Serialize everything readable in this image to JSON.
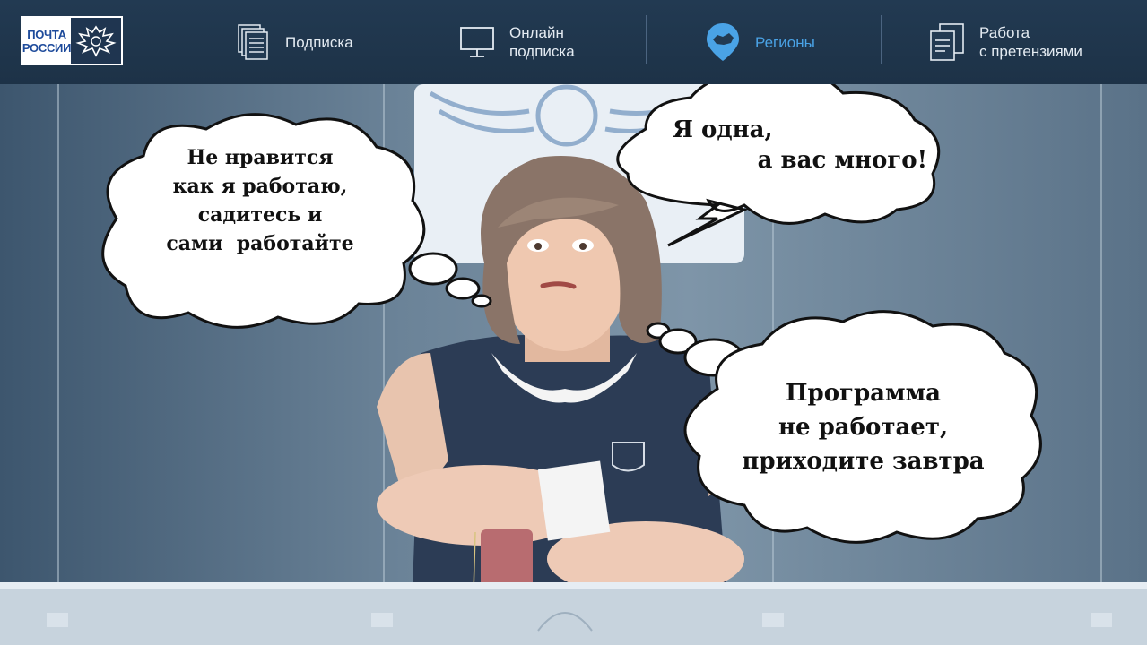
{
  "logo": {
    "line1": "ПОЧТА",
    "line2": "РОССИИ"
  },
  "nav": [
    {
      "label": "Подписка",
      "icon": "documents-icon",
      "active": false
    },
    {
      "label_line1": "Онлайн",
      "label_line2": "подписка",
      "icon": "monitor-icon",
      "active": false
    },
    {
      "label": "Регионы",
      "icon": "map-pin-icon",
      "active": true
    },
    {
      "label_line1": "Работа",
      "label_line2": "с претензиями",
      "icon": "claims-document-icon",
      "active": false
    }
  ],
  "bubbles": {
    "left": [
      "Не нравится",
      "как я работаю,",
      "садитесь и",
      "сами  работайте"
    ],
    "top_right": [
      "Я одна,",
      "а вас много!"
    ],
    "bottom_right": [
      "Программа",
      "не работает,",
      "приходите завтра"
    ]
  },
  "colors": {
    "header_bg": "#1f3549",
    "active_nav": "#4aa3e6",
    "brand_blue": "#1e4b9b"
  }
}
